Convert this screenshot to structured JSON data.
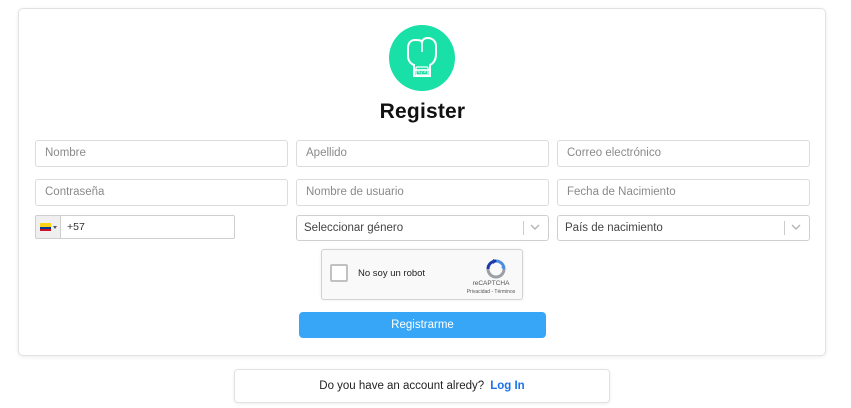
{
  "form": {
    "title": "Register",
    "fields": {
      "nombre_placeholder": "Nombre",
      "apellido_placeholder": "Apellido",
      "correo_placeholder": "Correo electrónico",
      "contrasena_placeholder": "Contraseña",
      "usuario_placeholder": "Nombre de usuario",
      "fecha_placeholder": "Fecha de Nacimiento",
      "phone_value": "+57",
      "genero_selected": "Seleccionar género",
      "pais_selected": "País de nacimiento"
    },
    "phone_flag": {
      "country": "Colombia",
      "colors": [
        "#fcd116",
        "#003893",
        "#ce1126"
      ]
    },
    "captcha": {
      "label": "No soy un robot",
      "brand": "reCAPTCHA",
      "links": "Privacidad - Términos"
    },
    "submit_label": "Registrarme"
  },
  "login_prompt": {
    "text": "Do you have an account alredy?",
    "link_label": "Log In"
  },
  "colors": {
    "logo_bg": "#19e0a6",
    "primary_button": "#38a6f7",
    "link": "#1a73e8"
  },
  "icons": {
    "logo": "boxing-glove-icon",
    "select_chevron": "chevron-down-icon",
    "captcha": "recaptcha-icon"
  }
}
